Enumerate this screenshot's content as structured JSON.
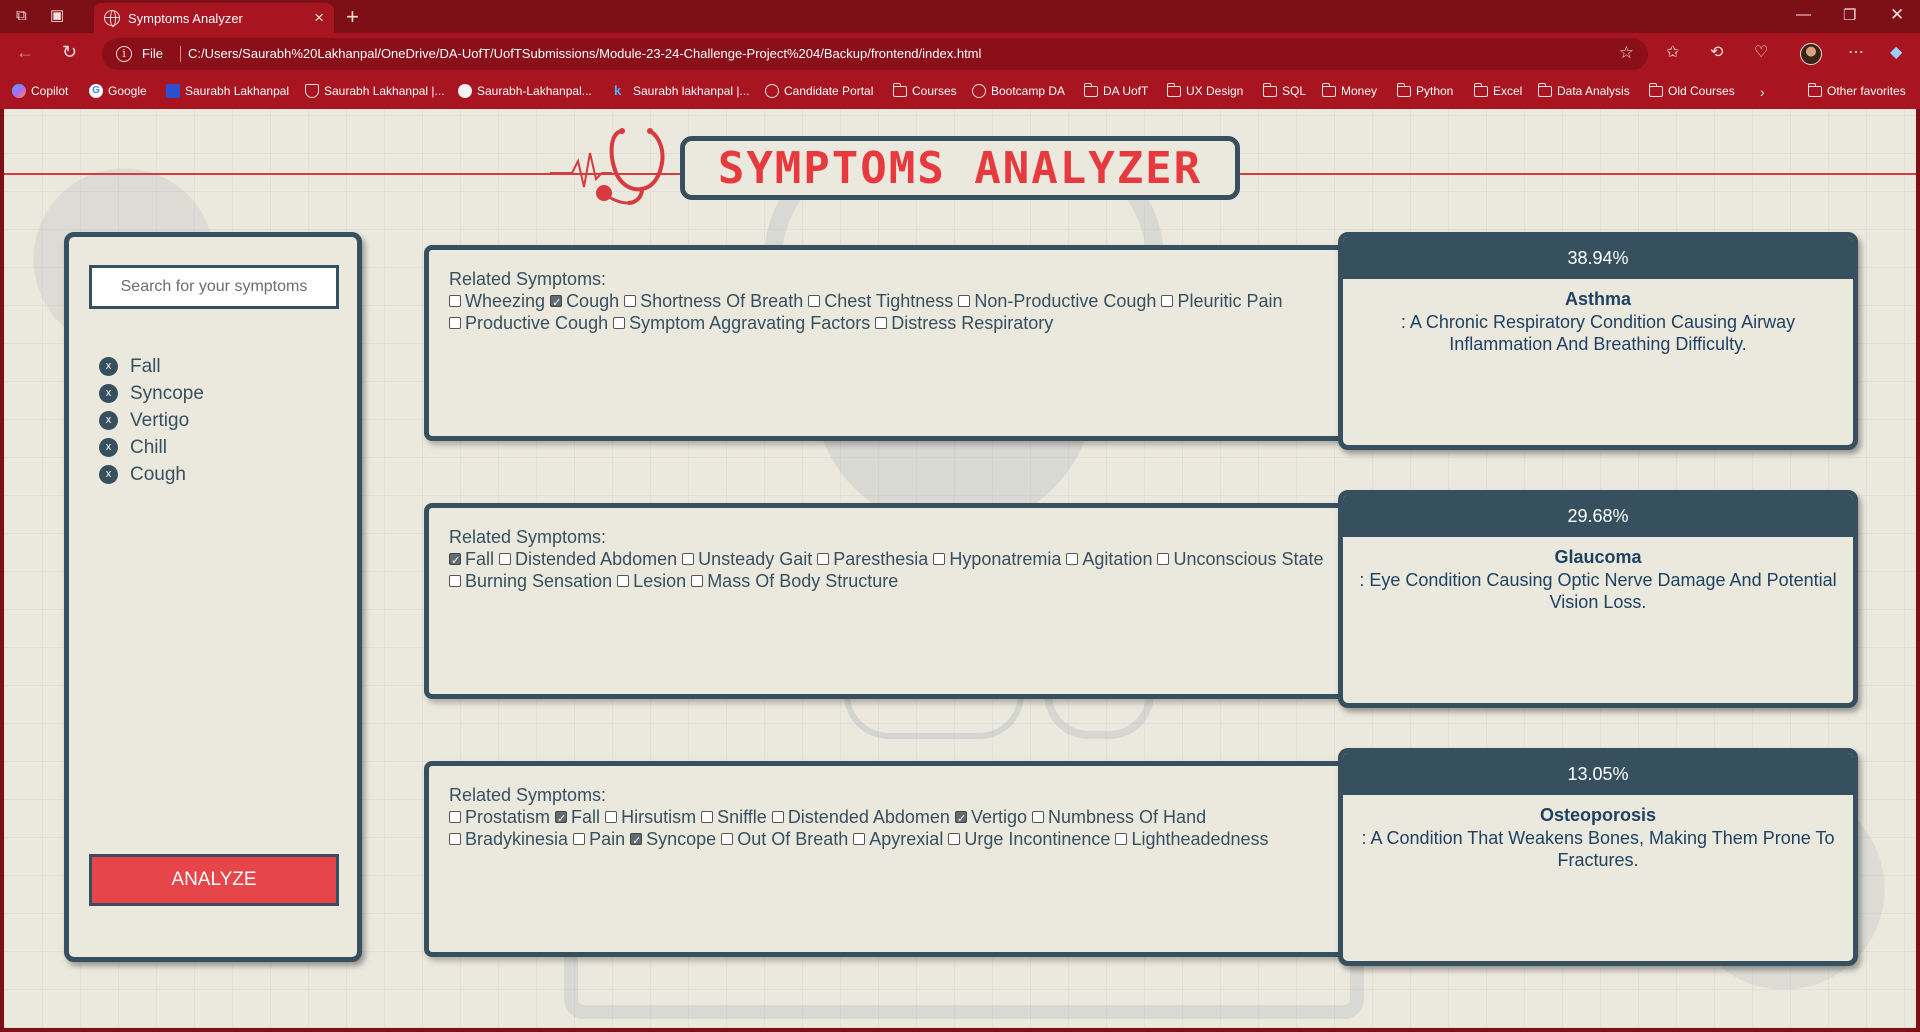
{
  "browser": {
    "tab_title": "Symptoms Analyzer",
    "file_label": "File",
    "url": "C:/Users/Saurabh%20Lakhanpal/OneDrive/DA-UofT/UofTSubmissions/Module-23-24-Challenge-Project%204/Backup/frontend/index.html",
    "bookmarks": [
      {
        "label": "Copilot",
        "icon": "copilot-icon"
      },
      {
        "label": "Google",
        "icon": "google-icon"
      },
      {
        "label": "Saurabh Lakhanpal",
        "icon": "bookmark-icon"
      },
      {
        "label": "Saurabh Lakhanpal |...",
        "icon": "shield-icon"
      },
      {
        "label": "Saurabh-Lakhanpal...",
        "icon": "github-icon"
      },
      {
        "label": "Saurabh lakhanpal |...",
        "icon": "k-icon"
      },
      {
        "label": "Candidate Portal",
        "icon": "globe-icon"
      },
      {
        "label": "Courses",
        "icon": "folder-icon"
      },
      {
        "label": "Bootcamp DA",
        "icon": "globe-icon"
      },
      {
        "label": "DA UofT",
        "icon": "folder-icon"
      },
      {
        "label": "UX Design",
        "icon": "folder-icon"
      },
      {
        "label": "SQL",
        "icon": "folder-icon"
      },
      {
        "label": "Money",
        "icon": "folder-icon"
      },
      {
        "label": "Python",
        "icon": "folder-icon"
      },
      {
        "label": "Excel",
        "icon": "folder-icon"
      },
      {
        "label": "Data Analysis",
        "icon": "folder-icon"
      },
      {
        "label": "Old Courses",
        "icon": "folder-icon"
      }
    ],
    "other_favorites": "Other favorites"
  },
  "app": {
    "title": "SYMPTOMS ANALYZER",
    "search_placeholder": "Search for your symptoms",
    "selected_symptoms": [
      "Fall",
      "Syncope",
      "Vertigo",
      "Chill",
      "Cough"
    ],
    "chip_remove": "x",
    "analyze_label": "ANALYZE",
    "related_label": "Related Symptoms:"
  },
  "results": [
    {
      "percent": "38.94%",
      "disease": "Asthma",
      "description": ": A Chronic Respiratory Condition Causing Airway Inflammation And Breathing Difficulty.",
      "symptoms": [
        {
          "label": "Wheezing",
          "checked": false
        },
        {
          "label": "Cough",
          "checked": true
        },
        {
          "label": "Shortness Of Breath",
          "checked": false
        },
        {
          "label": "Chest Tightness",
          "checked": false
        },
        {
          "label": "Non-Productive Cough",
          "checked": false
        },
        {
          "label": "Pleuritic Pain",
          "checked": false
        },
        {
          "label": "Productive Cough",
          "checked": false
        },
        {
          "label": "Symptom Aggravating Factors",
          "checked": false
        },
        {
          "label": "Distress Respiratory",
          "checked": false
        }
      ]
    },
    {
      "percent": "29.68%",
      "disease": "Glaucoma",
      "description": ": Eye Condition Causing Optic Nerve Damage And Potential Vision Loss.",
      "symptoms": [
        {
          "label": "Fall",
          "checked": true
        },
        {
          "label": "Distended Abdomen",
          "checked": false
        },
        {
          "label": "Unsteady Gait",
          "checked": false
        },
        {
          "label": "Paresthesia",
          "checked": false
        },
        {
          "label": "Hyponatremia",
          "checked": false
        },
        {
          "label": "Agitation",
          "checked": false
        },
        {
          "label": "Unconscious State",
          "checked": false
        },
        {
          "label": "Burning Sensation",
          "checked": false
        },
        {
          "label": "Lesion",
          "checked": false
        },
        {
          "label": "Mass Of Body Structure",
          "checked": false
        }
      ]
    },
    {
      "percent": "13.05%",
      "disease": "Osteoporosis",
      "description": ": A Condition That Weakens Bones, Making Them Prone To Fractures.",
      "symptoms": [
        {
          "label": "Prostatism",
          "checked": false
        },
        {
          "label": "Fall",
          "checked": true
        },
        {
          "label": "Hirsutism",
          "checked": false
        },
        {
          "label": "Sniffle",
          "checked": false
        },
        {
          "label": "Distended Abdomen",
          "checked": false
        },
        {
          "label": "Vertigo",
          "checked": true
        },
        {
          "label": "Numbness Of Hand",
          "checked": false
        },
        {
          "label": "Bradykinesia",
          "checked": false
        },
        {
          "label": "Pain",
          "checked": false
        },
        {
          "label": "Syncope",
          "checked": true
        },
        {
          "label": "Out Of Breath",
          "checked": false
        },
        {
          "label": "Apyrexial",
          "checked": false
        },
        {
          "label": "Urge Incontinence",
          "checked": false
        },
        {
          "label": "Lightheadedness",
          "checked": false
        }
      ]
    }
  ]
}
